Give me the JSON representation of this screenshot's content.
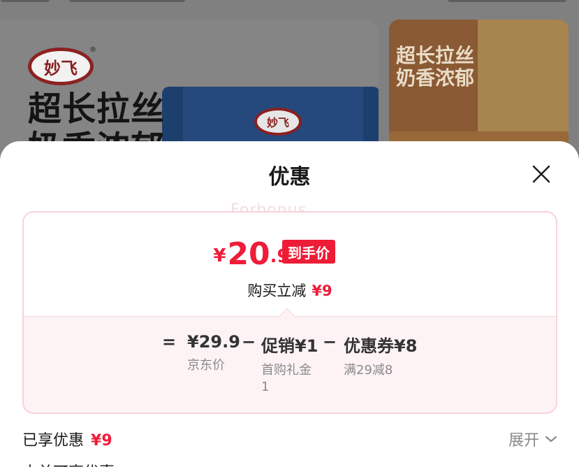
{
  "background": {
    "brand_logo": "妙飞",
    "headline_line1": "超长拉丝",
    "headline_line2": "奶香浓郁",
    "side_banner_line1": "超长拉丝",
    "side_banner_line2": "奶香浓郁"
  },
  "sheet": {
    "title": "优惠",
    "close_icon": "close-icon",
    "watermark": "Forbonus"
  },
  "price": {
    "currency": "¥",
    "integer": "20",
    "decimal": ".9",
    "badge": "到手价",
    "instant_label": "购买立减",
    "instant_amount": "¥9"
  },
  "breakdown": {
    "eq_sign": "=",
    "minus": "−",
    "items": [
      {
        "value": "¥29.9",
        "sub": "京东价"
      },
      {
        "value": "促销¥1",
        "sub": "首购礼金\n1"
      },
      {
        "value": "优惠券¥8",
        "sub": "满29减8"
      }
    ]
  },
  "summary": {
    "enjoyed_label": "已享优惠",
    "enjoyed_amount": "¥9",
    "expand_label": "展开",
    "expand_icon": "chevron-down-icon",
    "next_section_label": "本单可享优惠"
  },
  "colors": {
    "accent_red": "#ee1d3a",
    "card_border": "#f9d2da",
    "breakdown_bg": "#fdf3f5"
  }
}
